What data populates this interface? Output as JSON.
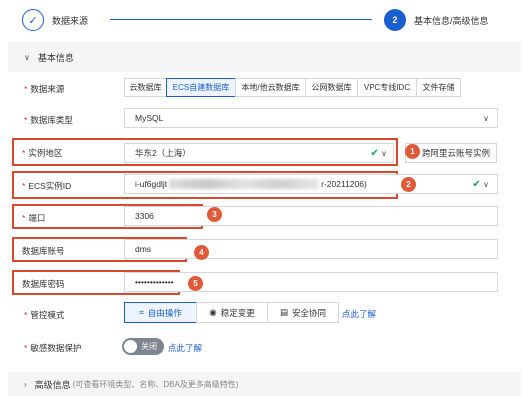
{
  "steps": [
    {
      "label": "数据来源",
      "icon": "check-icon",
      "state": "done"
    },
    {
      "number": "2",
      "label": "基本信息/高级信息",
      "state": "active"
    }
  ],
  "section": {
    "title": "基本信息"
  },
  "fields": {
    "source": {
      "label": "数据来源",
      "options": [
        "云数据库",
        "ECS自建数据库",
        "本地/他云数据库",
        "公网数据库",
        "VPC专线IDC",
        "文件存储"
      ],
      "selected": "ECS自建数据库"
    },
    "db_type": {
      "label": "数据库类型",
      "value": "MySQL"
    },
    "region": {
      "label": "实例地区",
      "value": "华东2（上海）",
      "side_button": "跨阿里云账号实例"
    },
    "ecs_id": {
      "label": "ECS实例ID",
      "prefix": "i-uf6gdljt",
      "suffix": "r-20211206)"
    },
    "port": {
      "label": "端口",
      "value": "3306"
    },
    "account": {
      "label": "数据库账号",
      "value": "dms"
    },
    "password": {
      "label": "数据库密码",
      "value": "•••••••••••••"
    },
    "control_mode": {
      "label": "管控模式",
      "options": [
        {
          "label": "自由操作",
          "icon": "free-op-icon"
        },
        {
          "label": "稳定变更",
          "icon": "stable-change-icon"
        },
        {
          "label": "安全协同",
          "icon": "secure-collab-icon"
        }
      ],
      "selected": "自由操作",
      "learn_more": "点此了解"
    },
    "sensitive": {
      "label": "敏感数据保护",
      "toggle_text": "关闭",
      "learn_more": "点此了解"
    }
  },
  "badges": [
    "1",
    "2",
    "3",
    "4",
    "5"
  ],
  "advanced": {
    "title": "高级信息",
    "hint": "(可查看环境类型、名称、DBA及更多高级特性)"
  },
  "colors": {
    "accent": "#1a5fd0",
    "highlight": "#d9482b",
    "success": "#19a25c"
  }
}
